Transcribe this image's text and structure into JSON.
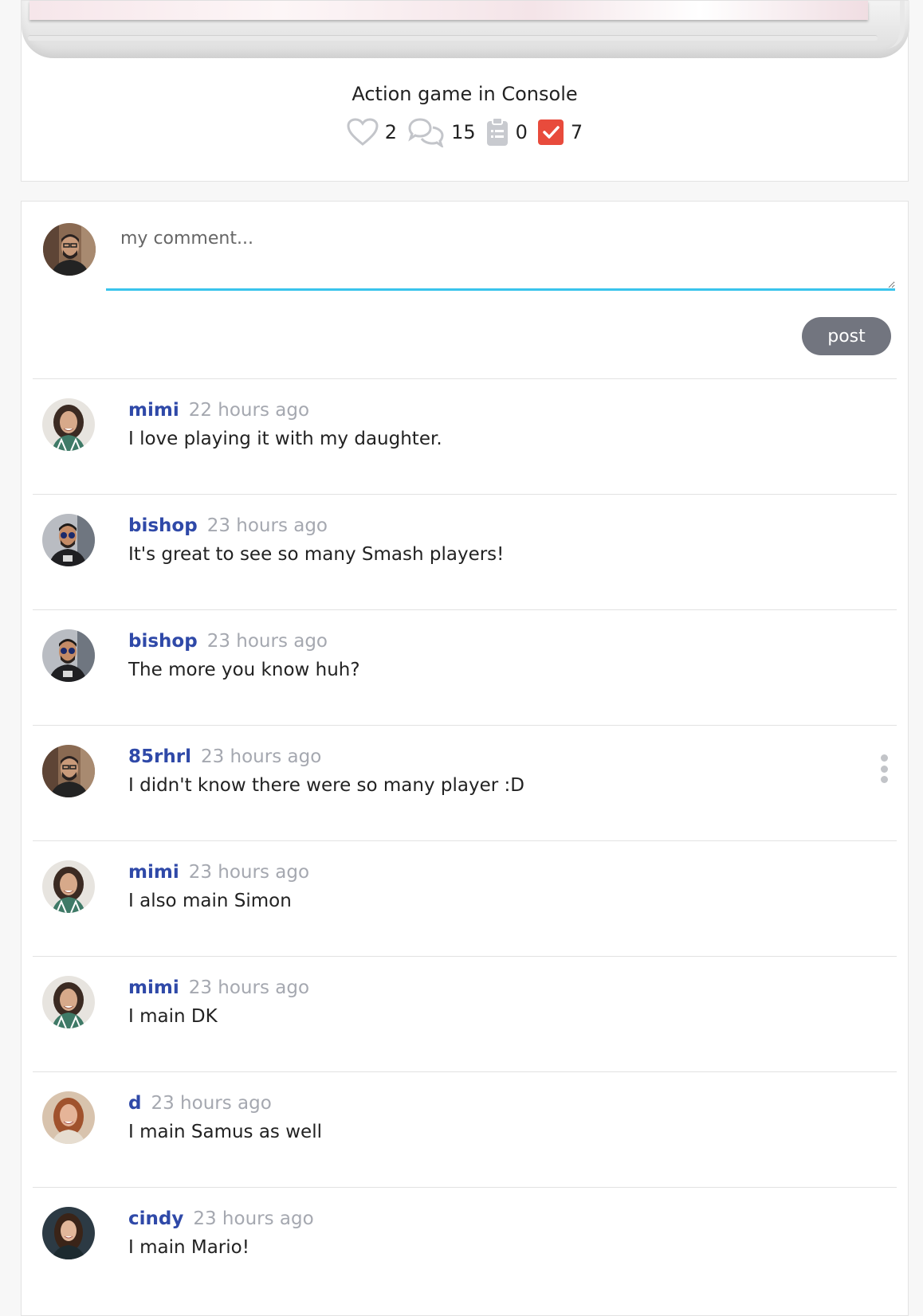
{
  "post": {
    "title": "Action game in Console",
    "stats": {
      "likes": "2",
      "comments": "15",
      "clipboard": "0",
      "checked": "7"
    },
    "colors": {
      "check_accent": "#e84b3c",
      "link_blue": "#2f49a8",
      "input_underline": "#39c4ec"
    }
  },
  "composer": {
    "placeholder": "my comment...",
    "post_label": "post",
    "avatar": "bearded-man-avatar"
  },
  "comments": [
    {
      "author": "mimi",
      "time": "22 hours ago",
      "text": "I love playing it with my daughter.",
      "avatar": "curly-hair-woman-avatar",
      "has_menu": false
    },
    {
      "author": "bishop",
      "time": "23 hours ago",
      "text": "It's great to see so many Smash players!",
      "avatar": "sunglasses-man-avatar",
      "has_menu": false
    },
    {
      "author": "bishop",
      "time": "23 hours ago",
      "text": "The more you know huh?",
      "avatar": "sunglasses-man-avatar",
      "has_menu": false
    },
    {
      "author": "85rhrl",
      "time": "23 hours ago",
      "text": "I didn't know there were so many player :D",
      "avatar": "bearded-man-avatar",
      "has_menu": true
    },
    {
      "author": "mimi",
      "time": "23 hours ago",
      "text": "I also main Simon",
      "avatar": "curly-hair-woman-avatar",
      "has_menu": false
    },
    {
      "author": "mimi",
      "time": "23 hours ago",
      "text": "I main DK",
      "avatar": "curly-hair-woman-avatar",
      "has_menu": false
    },
    {
      "author": "d",
      "time": "23 hours ago",
      "text": "I main Samus as well",
      "avatar": "red-hair-woman-avatar",
      "has_menu": false
    },
    {
      "author": "cindy",
      "time": "23 hours ago",
      "text": "I main Mario!",
      "avatar": "dark-hair-woman-avatar",
      "has_menu": false
    }
  ]
}
